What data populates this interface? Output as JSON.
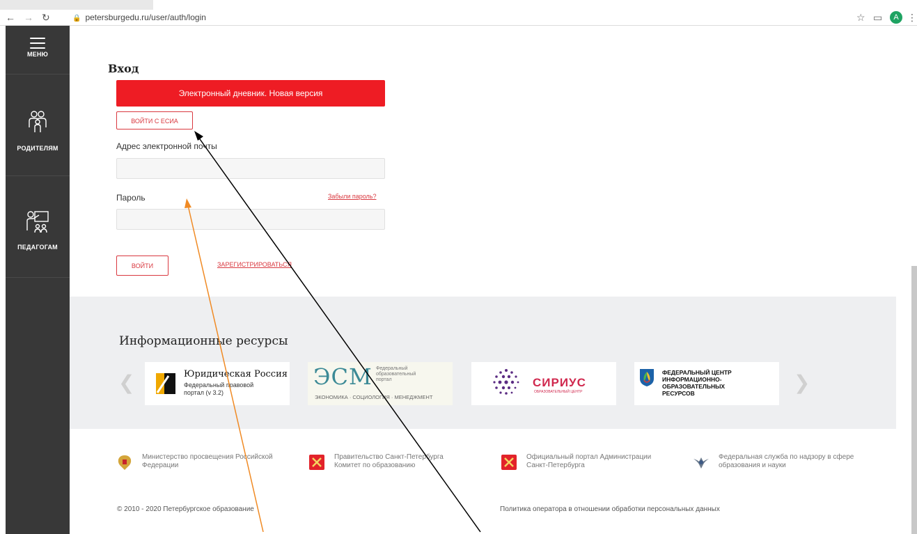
{
  "browser": {
    "url": "petersburgedu.ru/user/auth/login",
    "avatar_letter": "A"
  },
  "sidebar": {
    "menu_label": "МЕНЮ",
    "parents_label": "РОДИТЕЛЯМ",
    "teachers_label": "ПЕДАГОГАМ"
  },
  "login": {
    "title": "Вход",
    "banner": "Электронный дневник. Новая версия",
    "esia_button": "ВОЙТИ С ЕСИА",
    "email_label": "Адрес электронной почты",
    "email_value": "",
    "password_label": "Пароль",
    "password_value": "",
    "forgot_link": "Забыли пароль?",
    "login_button": "ВОЙТИ",
    "register_link": "ЗАРЕГИСТРИРОВАТЬСЯ"
  },
  "resources": {
    "title": "Информационные ресурсы",
    "cards": [
      {
        "title": "Юридическая Россия",
        "line1": "Федеральный правовой",
        "line2": "портал (v 3.2)"
      },
      {
        "title": "ЭСМ",
        "line1": "Федеральный",
        "line2": "образовательный",
        "line3": "портал",
        "bottom": "ЭКОНОМИКА · СОЦИОЛОГИЯ · МЕНЕДЖМЕНТ"
      },
      {
        "title": "СИРИУС",
        "sub": "ОБРАЗОВАТЕЛЬНЫЙ ЦЕНТР"
      },
      {
        "line1": "ФЕДЕРАЛЬНЫЙ ЦЕНТР",
        "line2": "ИНФОРМАЦИОННО-ОБРАЗОВАТЕЛЬНЫХ",
        "line3": "РЕСУРСОВ"
      }
    ]
  },
  "footer": {
    "links": [
      "Министерство просвещения Российской Федерации",
      "Правительство Санкт-Петербурга Комитет по образованию",
      "Официальный портал Администрации Санкт-Петербурга",
      "Федеральная служба по надзору в сфере образования и науки"
    ],
    "copyright": "© 2010 - 2020 Петербургское образование",
    "privacy": "Политика оператора в отношении обработки персональных данных"
  },
  "colors": {
    "accent": "#ee1c24",
    "link": "#d9383f",
    "sidebar": "#383838"
  }
}
